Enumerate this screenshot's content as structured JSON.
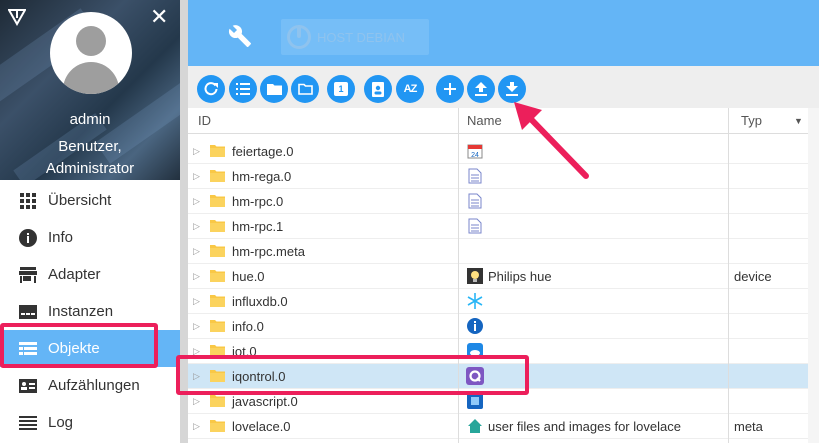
{
  "profile": {
    "name": "admin",
    "role_line1": "Benutzer,",
    "role_line2": "Administrator"
  },
  "nav": {
    "items": [
      {
        "label": "Übersicht",
        "icon": "grid-icon"
      },
      {
        "label": "Info",
        "icon": "info-icon"
      },
      {
        "label": "Adapter",
        "icon": "store-icon"
      },
      {
        "label": "Instanzen",
        "icon": "instances-icon"
      },
      {
        "label": "Objekte",
        "icon": "list-icon",
        "active": true
      },
      {
        "label": "Aufzählungen",
        "icon": "enum-icon"
      },
      {
        "label": "Log",
        "icon": "log-icon"
      }
    ]
  },
  "header": {
    "host_label": "HOST DEBIAN"
  },
  "toolbar": {
    "buttons": [
      "refresh-icon",
      "list-view-icon",
      "folder-icon",
      "folder-outline-icon",
      "number-icon",
      "user-badge-icon",
      "sort-az-icon",
      "add-icon",
      "upload-icon",
      "download-icon"
    ],
    "sort_label": "AZ",
    "number_label": "1"
  },
  "table": {
    "columns": {
      "id": "ID",
      "name": "Name",
      "typ": "Typ"
    },
    "rows": [
      {
        "id": "feiertage.0",
        "name": "",
        "typ": "",
        "icon": "calendar-icon"
      },
      {
        "id": "hm-rega.0",
        "name": "",
        "typ": "",
        "icon": "doc-icon"
      },
      {
        "id": "hm-rpc.0",
        "name": "",
        "typ": "",
        "icon": "doc-icon"
      },
      {
        "id": "hm-rpc.1",
        "name": "",
        "typ": "",
        "icon": "doc-icon"
      },
      {
        "id": "hm-rpc.meta",
        "name": "",
        "typ": "",
        "icon": ""
      },
      {
        "id": "hue.0",
        "name": "Philips hue",
        "typ": "device",
        "icon": "hue-icon"
      },
      {
        "id": "influxdb.0",
        "name": "",
        "typ": "",
        "icon": "snowflake-icon"
      },
      {
        "id": "info.0",
        "name": "",
        "typ": "",
        "icon": "info-blue-icon"
      },
      {
        "id": "iot.0",
        "name": "",
        "typ": "",
        "icon": "cloud-icon"
      },
      {
        "id": "iqontrol.0",
        "name": "",
        "typ": "",
        "icon": "iqontrol-icon",
        "selected": true
      },
      {
        "id": "javascript.0",
        "name": "",
        "typ": "",
        "icon": "js-icon"
      },
      {
        "id": "lovelace.0",
        "name": "user files and images for lovelace",
        "typ": "meta",
        "icon": "home-icon"
      }
    ]
  },
  "colors": {
    "accent": "#64b5f6",
    "button": "#2196f3",
    "highlight": "#ec1f5b",
    "selected_row": "#cfe6f6"
  }
}
